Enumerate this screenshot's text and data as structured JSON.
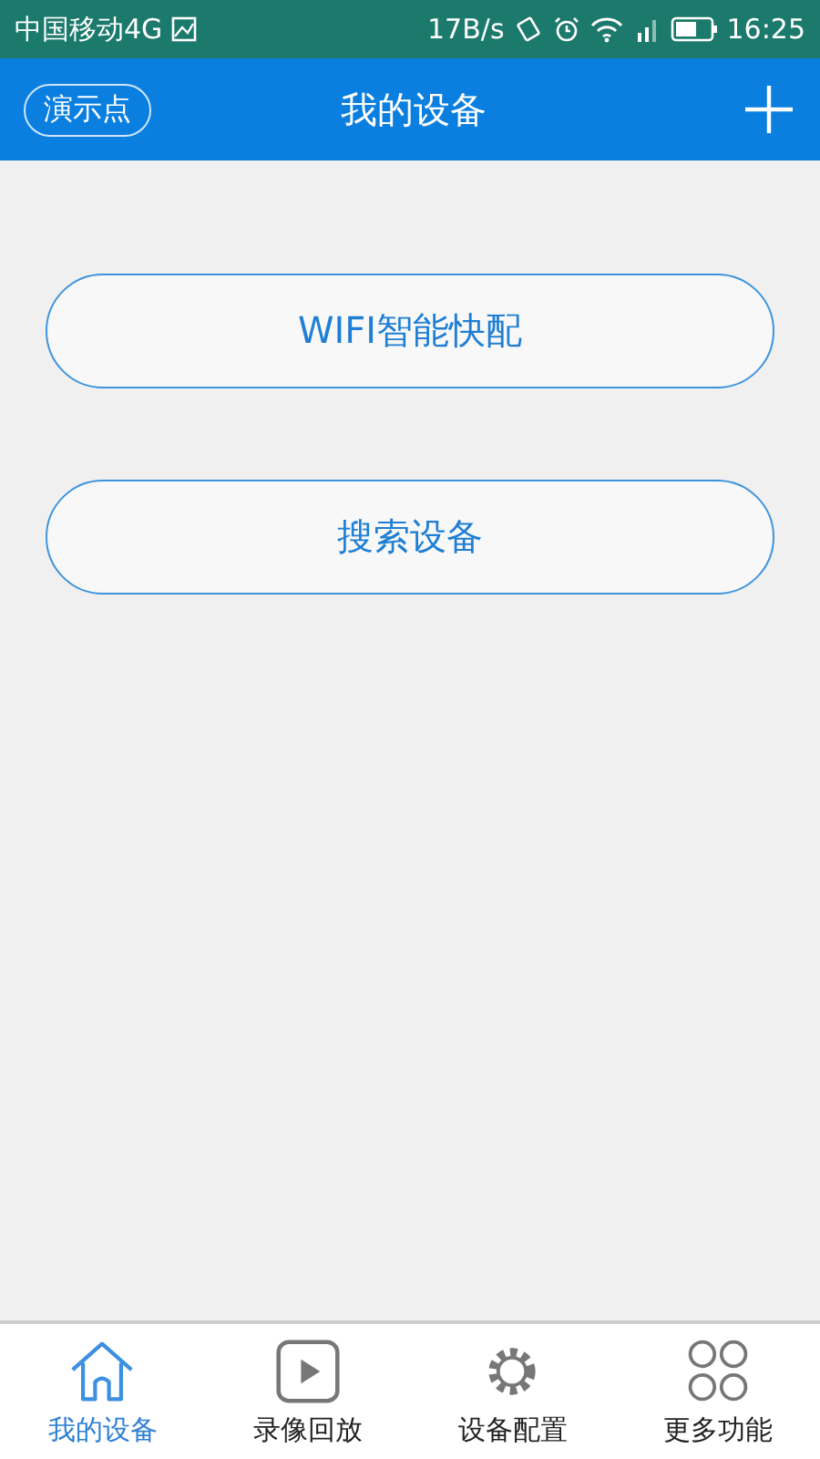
{
  "status_bar": {
    "carrier": "中国移动4G",
    "speed": "17B/s",
    "time": "16:25"
  },
  "header": {
    "badge": "演示点",
    "title": "我的设备"
  },
  "buttons": [
    "WIFI智能快配",
    "搜索设备"
  ],
  "tabs": [
    {
      "label": "我的设备",
      "kind": "home",
      "selected": true
    },
    {
      "label": "录像回放",
      "kind": "play",
      "selected": false
    },
    {
      "label": "设备配置",
      "kind": "gear",
      "selected": false
    },
    {
      "label": "更多功能",
      "kind": "more",
      "selected": false
    }
  ]
}
